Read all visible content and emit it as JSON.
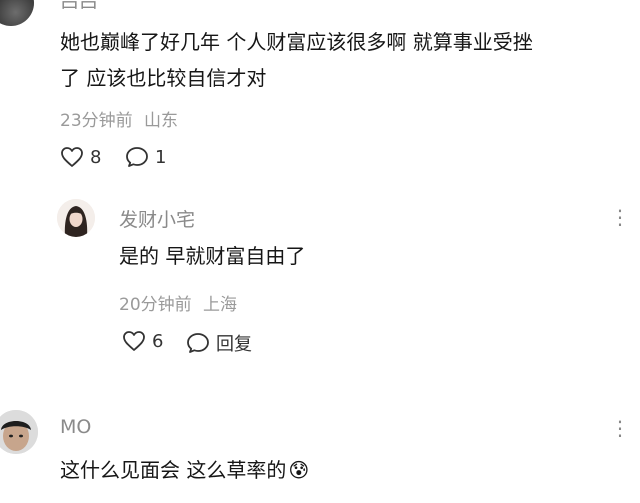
{
  "comment1": {
    "username": "吕吕",
    "text_line1": "她也巅峰了好几年 个人财富应该很多啊 就算事业受挫",
    "text_line2": "了 应该也比较自信才对",
    "time": "23分钟前",
    "location": "山东",
    "likes": "8",
    "replies": "1"
  },
  "reply1": {
    "username": "发财小宅",
    "text": "是的 早就财富自由了",
    "time": "20分钟前",
    "location": "上海",
    "likes": "6",
    "reply_label": "回复",
    "more": "⋮"
  },
  "comment2": {
    "username": "MO",
    "text": "这什么见面会 这么草率的",
    "emoji": "😰",
    "more": "⋮"
  }
}
